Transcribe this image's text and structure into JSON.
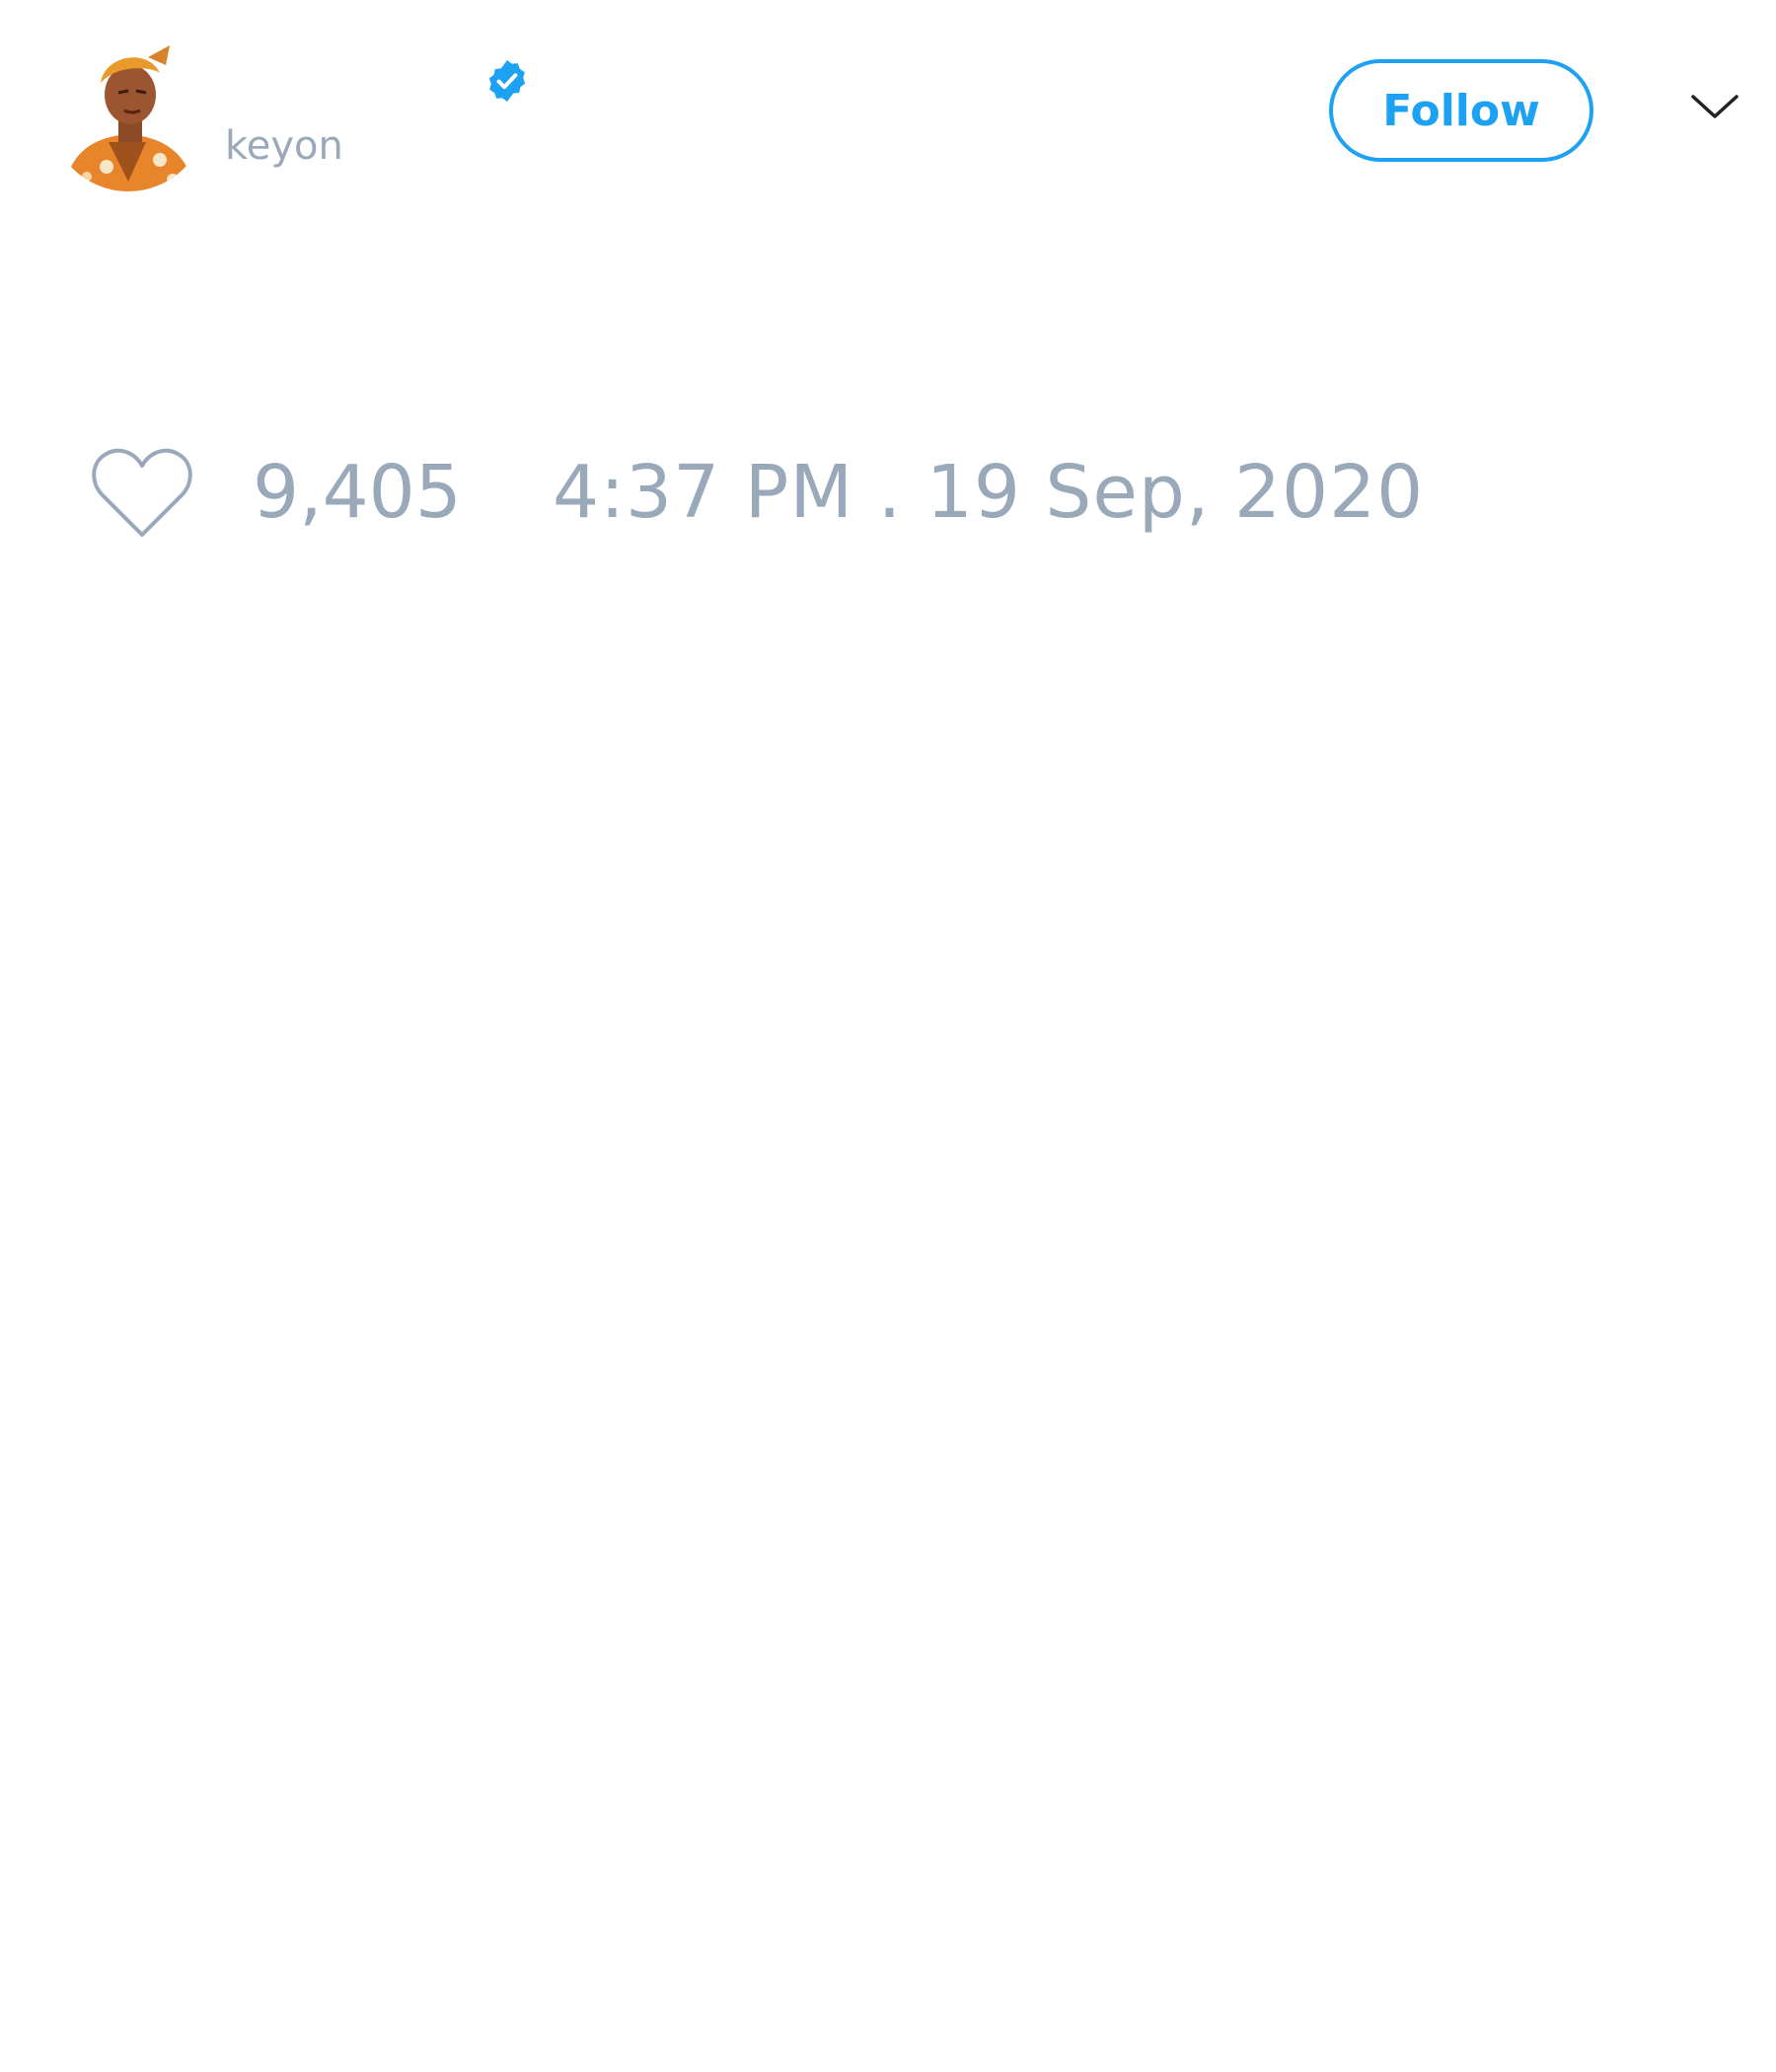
{
  "tweet": {
    "author": {
      "handle": "keyon",
      "verified": true,
      "avatar_icon": "illustrated-avatar"
    },
    "follow_label": "Follow",
    "menu_icon": "chevron-down-icon",
    "like_icon": "heart-icon",
    "like_count": "9,405",
    "timestamp": "4:37 PM . 19 Sep, 2020"
  },
  "colors": {
    "accent": "#1da1f2",
    "muted_text": "#99a9ba",
    "background": "#ffffff"
  }
}
